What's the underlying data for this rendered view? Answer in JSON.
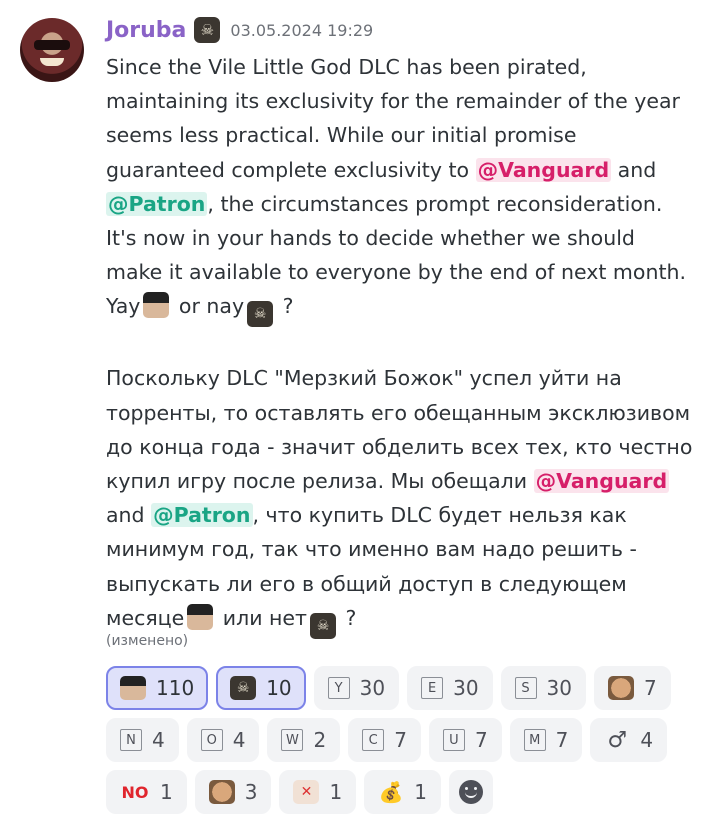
{
  "message": {
    "author": "Joruba",
    "timestamp": "03.05.2024 19:29",
    "edited_label": "(изменено)",
    "paragraph1": {
      "part1": "Since the Vile Little God DLC has been pirated, maintaining its exclusivity for the remainder of the year seems less practical. While our initial promise guaranteed complete exclusivity to ",
      "mention1": "@Vanguard",
      "part2": " and ",
      "mention2": "@Patron",
      "part3": ", the circumstances prompt reconsideration. It's now in your hands to decide whether we should make it available to everyone by the end of next month. Yay",
      "part4": " or nay",
      "part5": " ?"
    },
    "paragraph2": {
      "part1": "Поскольку DLC \"Мерзкий Божок\" успел уйти на торренты, то оставлять его обещанным эксклюзивом до конца года - значит обделить всех тех, кто честно купил игру после релиза. Мы обещали ",
      "mention1": "@Vanguard",
      "part2": " and ",
      "mention2": "@Patron",
      "part3": ", что купить DLC будет нельзя как минимум год, так что именно вам надо решить - выпускать ли его в общий доступ в следующем месяце",
      "part4": " или нет",
      "part5": " ?"
    }
  },
  "reactions": [
    {
      "icon": "pirate-captain-emoji",
      "count": "110",
      "active": true
    },
    {
      "icon": "skull-crossbones-emoji",
      "count": "10",
      "active": true
    },
    {
      "icon": "letter-y",
      "glyph": "Y",
      "count": "30"
    },
    {
      "icon": "letter-e",
      "glyph": "E",
      "count": "30"
    },
    {
      "icon": "letter-s",
      "glyph": "S",
      "count": "30"
    },
    {
      "icon": "face-emoji",
      "count": "7"
    },
    {
      "icon": "letter-n",
      "glyph": "N",
      "count": "4"
    },
    {
      "icon": "letter-o",
      "glyph": "O",
      "count": "4"
    },
    {
      "icon": "letter-w",
      "glyph": "W",
      "count": "2"
    },
    {
      "icon": "letter-c",
      "glyph": "C",
      "count": "7"
    },
    {
      "icon": "letter-u",
      "glyph": "U",
      "count": "7"
    },
    {
      "icon": "letter-m",
      "glyph": "M",
      "count": "7"
    },
    {
      "icon": "male-sign",
      "glyph": "♂",
      "count": "4"
    },
    {
      "icon": "no-sign",
      "glyph": "NO",
      "count": "1"
    },
    {
      "icon": "laughing-face-emoji",
      "count": "3"
    },
    {
      "icon": "angry-cat-emoji",
      "count": "1"
    },
    {
      "icon": "money-bag-emoji",
      "glyph": "💰",
      "count": "1"
    }
  ],
  "colors": {
    "username": "#8a63c7",
    "vanguard_mention": "#d61f69",
    "patron_mention": "#1aa585",
    "active_reaction_border": "#7c83e8"
  }
}
